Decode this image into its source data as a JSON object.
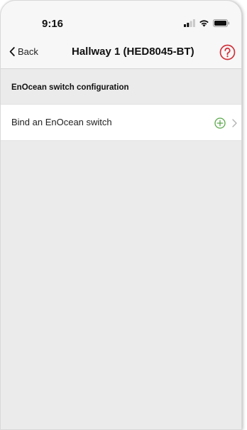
{
  "status_bar": {
    "time": "9:16",
    "signal_icon": "cellular-signal-icon",
    "wifi_icon": "wifi-icon",
    "battery_icon": "battery-icon"
  },
  "nav": {
    "back_label": "Back",
    "title": "Hallway 1 (HED8045-BT)",
    "help_icon": "help-circle-icon"
  },
  "section": {
    "header": "EnOcean switch configuration",
    "items": [
      {
        "label": "Bind an EnOcean switch",
        "action_icon": "add-circle-icon"
      }
    ]
  },
  "colors": {
    "accent_red": "#d0313a",
    "add_green": "#5aa84a",
    "background": "#ebebeb",
    "bar": "#f7f7f7"
  }
}
